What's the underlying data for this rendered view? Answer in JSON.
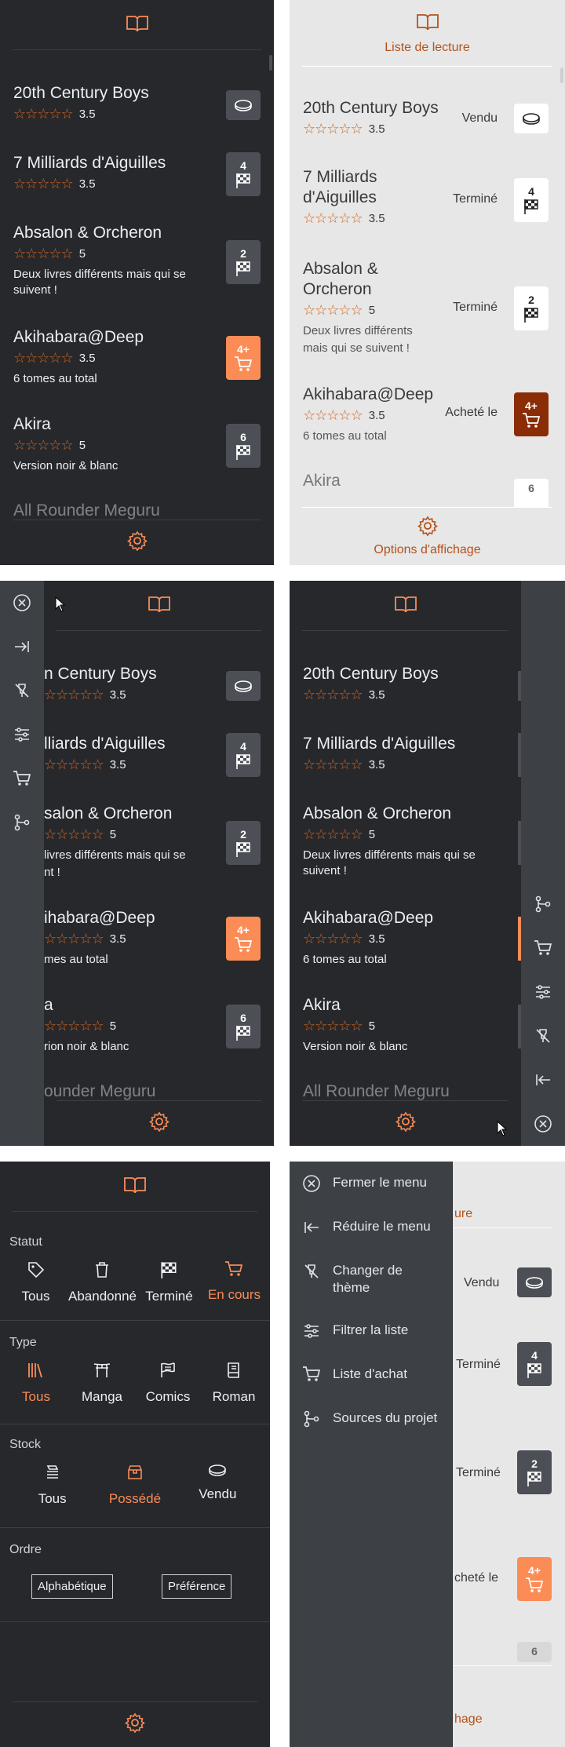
{
  "app": {
    "header_title": "Liste de lecture",
    "footer_label": "Options d'affichage"
  },
  "items": [
    {
      "title": "20th Century Boys",
      "title_l1": "20th Century Boys",
      "title_l2": "",
      "rating": 3.5,
      "stars": "☆☆☆☆☆",
      "rating_label": "3.5",
      "note": "",
      "badge": "",
      "status": "Vendu",
      "badge_icon": "coin-icon",
      "title_cut": "n Century Boys"
    },
    {
      "title": "7 Milliards d'Aiguilles",
      "title_l1": "7 Milliards",
      "title_l2": "d'Aiguilles",
      "rating": 3.5,
      "stars": "☆☆☆☆☆",
      "rating_label": "3.5",
      "note": "",
      "badge": "4",
      "status": "Terminé",
      "badge_icon": "checkered-flag-icon",
      "title_cut": "lliards d'Aiguilles"
    },
    {
      "title": "Absalon & Orcheron",
      "title_l1": "Absalon &",
      "title_l2": "Orcheron",
      "rating": 5,
      "stars": "☆☆☆☆☆",
      "rating_label": "5",
      "note": "Deux livres différents mais qui se suivent !",
      "note_l1": "Deux livres différents",
      "note_l2": "mais qui se suivent !",
      "badge": "2",
      "status": "Terminé",
      "badge_icon": "checkered-flag-icon",
      "title_cut": "salon & Orcheron",
      "note_cut_l1": " livres différents mais qui se",
      "note_cut_l2": "nt !"
    },
    {
      "title": "Akihabara@Deep",
      "title_l1": "Akihabara@Deep",
      "title_l2": "",
      "rating": 3.5,
      "stars": "☆☆☆☆☆",
      "rating_label": "3.5",
      "note": "6 tomes au total",
      "badge": "4+",
      "status": "Acheté le",
      "badge_icon": "cart-icon",
      "title_cut": "ihabara@Deep",
      "note_cut": "mes au total"
    },
    {
      "title": "Akira",
      "title_l1": "Akira",
      "title_l2": "",
      "rating": 5,
      "stars": "☆☆☆☆☆",
      "rating_label": "5",
      "note": "Version noir & blanc",
      "badge": "6",
      "status": "",
      "badge_icon": "checkered-flag-icon",
      "title_cut": "a",
      "note_cut": "rion noir & blanc"
    },
    {
      "title": "All Rounder Meguru",
      "title_cut": "ounder Meguru"
    }
  ],
  "filters": {
    "statut": {
      "label": "Statut",
      "options": [
        "Tous",
        "Abandonné",
        "Terminé",
        "En cours"
      ],
      "selected": "En cours"
    },
    "type": {
      "label": "Type",
      "options": [
        "Tous",
        "Manga",
        "Comics",
        "Roman"
      ],
      "selected": "Tous"
    },
    "stock": {
      "label": "Stock",
      "options": [
        "Tous",
        "Possédé",
        "Vendu"
      ],
      "selected": "Possédé"
    },
    "ordre": {
      "label": "Ordre",
      "options": [
        "Alphabétique",
        "Préférence"
      ]
    }
  },
  "menu": {
    "items": [
      "Fermer le menu",
      "Réduire le menu",
      "Changer de thème",
      "Filtrer la liste",
      "Liste d'achat",
      "Sources du projet"
    ],
    "theme_l1": "Changer de",
    "theme_l2": "thème"
  },
  "partial": {
    "header_cut": "ure",
    "footer_cut": "hage",
    "status_cut": "́cheté le",
    "status_cut_text": "cheté le"
  },
  "colors": {
    "accent": "#fb8c56",
    "accent_dark": "#b5511a",
    "dark_bg": "#26282c",
    "light_bg": "#e7e7e7",
    "strip_bg": "#3d4045"
  }
}
